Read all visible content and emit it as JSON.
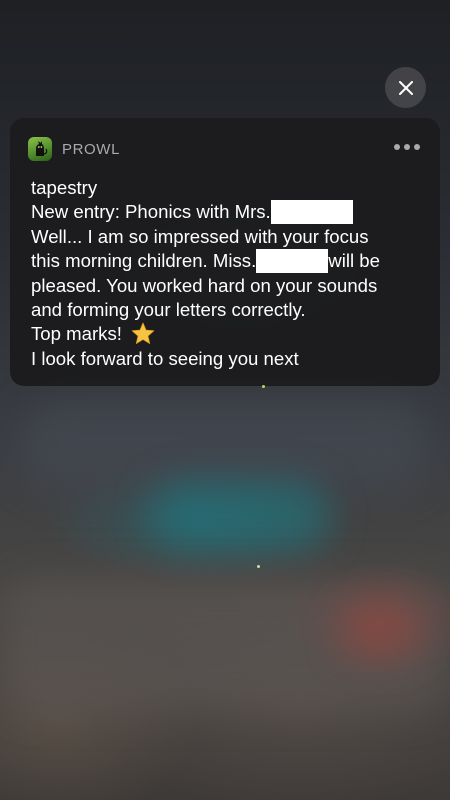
{
  "notification": {
    "app_name": "PROWL",
    "app_icon": "prowl-cat-icon",
    "title": "tapestry",
    "line1_prefix": "New entry: Phonics with Mrs.",
    "line2": "Well... I am so impressed with your focus",
    "line3_prefix": "this morning children. Miss.",
    "line3_suffix": "will be",
    "line4": "pleased. You worked hard on your sounds",
    "line5": "and forming your letters correctly.",
    "line6_prefix": "Top marks!",
    "line6_icon": "star-icon",
    "line7": "I look forward to seeing you next"
  },
  "controls": {
    "close_icon": "close-icon",
    "more_icon": "more-options-icon"
  },
  "colors": {
    "card_background": "#1c1c1e",
    "secondary_text": "#a9a9ae",
    "primary_text": "#ffffff",
    "star": "#f6c343"
  }
}
